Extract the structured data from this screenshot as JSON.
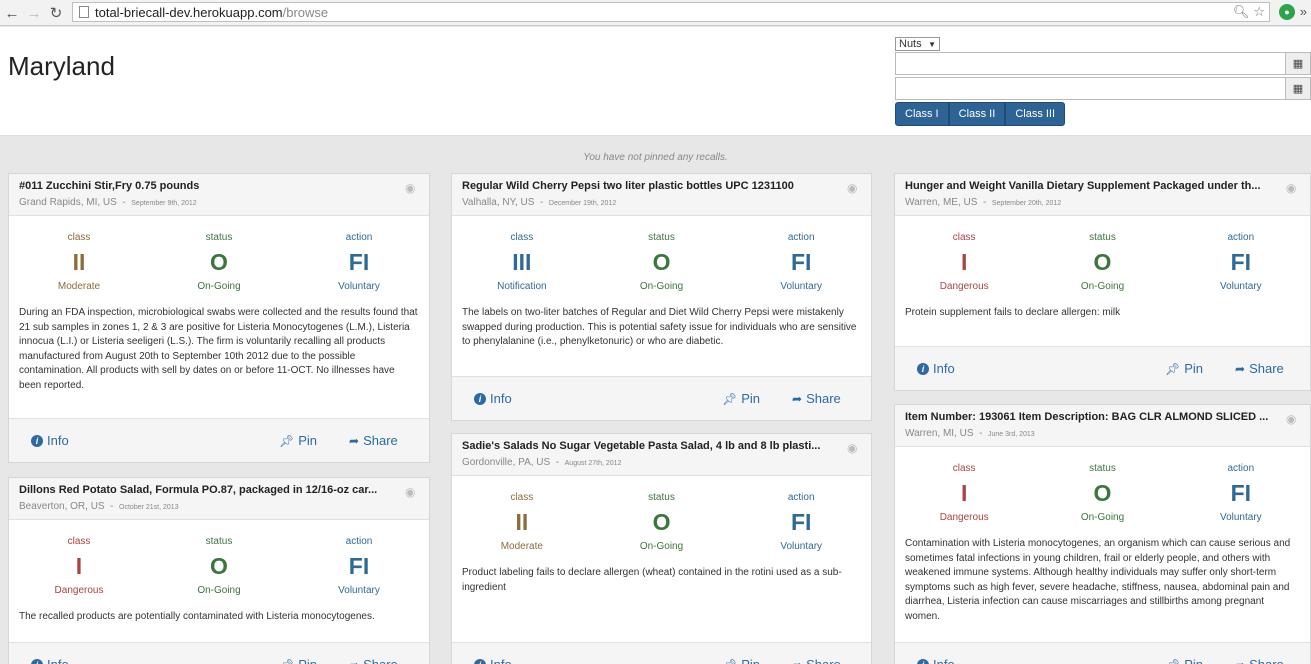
{
  "browser": {
    "url_host": "total-briecall-dev.herokuapp.com",
    "url_path": "/browse",
    "back_icon": "arrow-left-icon",
    "forward_icon": "arrow-right-icon",
    "reload_icon": "reload-icon"
  },
  "header": {
    "state": "Maryland",
    "category": "Nuts",
    "class_buttons": [
      "Class I",
      "Class II",
      "Class III"
    ]
  },
  "pinned_message": "You have not pinned any recalls.",
  "labels": {
    "class": "class",
    "status": "status",
    "action": "action",
    "info": "Info",
    "pin": "Pin",
    "share": "Share"
  },
  "cards": [
    {
      "title": "#011 Zucchini Stir,Fry 0.75 pounds",
      "location": "Grand Rapids, MI, US",
      "date": "September 9th, 2012",
      "class": "II",
      "class_desc": "Moderate",
      "status": "O",
      "status_desc": "On-Going",
      "action": "FI",
      "action_desc": "Voluntary",
      "description": "During an FDA inspection, microbiological swabs were collected and the results found that 21 sub samples in zones 1, 2 & 3 are positive for Listeria Monocytogenes (L.M.), Listeria innocua (L.I.) or Listeria seeligeri (L.S.). The firm is voluntarily recalling all products manufactured from August 20th to September 10th 2012 due to the possible contamination. All products with sell by dates on or before 11-OCT. No illnesses have been reported."
    },
    {
      "title": "Dillons Red Potato Salad, Formula PO.87, packaged in 12/16-oz car...",
      "location": "Beaverton, OR, US",
      "date": "October 21st, 2013",
      "class": "I",
      "class_desc": "Dangerous",
      "status": "O",
      "status_desc": "On-Going",
      "action": "FI",
      "action_desc": "Voluntary",
      "description": "The recalled products are potentially contaminated with Listeria monocytogenes."
    },
    {
      "title": "Regular Wild Cherry Pepsi two liter plastic bottles UPC 1231100",
      "location": "Valhalla, NY, US",
      "date": "December 19th, 2012",
      "class": "III",
      "class_desc": "Notification",
      "status": "O",
      "status_desc": "On-Going",
      "action": "FI",
      "action_desc": "Voluntary",
      "description": "The labels on two-liter batches of Regular and Diet Wild Cherry Pepsi were mistakenly swapped during production. This is potential safety issue for individuals who are sensitive to phenylalanine (i.e., phenylketonuric) or who are diabetic."
    },
    {
      "title": "Sadie's Salads No Sugar Vegetable Pasta Salad, 4 lb and 8 lb plasti...",
      "location": "Gordonville, PA, US",
      "date": "August 27th, 2012",
      "class": "II",
      "class_desc": "Moderate",
      "status": "O",
      "status_desc": "On-Going",
      "action": "FI",
      "action_desc": "Voluntary",
      "description": "Product labeling fails to declare allergen (wheat) contained in the rotini used as a sub-ingredient"
    },
    {
      "title": "Hunger and Weight Vanilla Dietary Supplement Packaged under th...",
      "location": "Warren, ME, US",
      "date": "September 20th, 2012",
      "class": "I",
      "class_desc": "Dangerous",
      "status": "O",
      "status_desc": "On-Going",
      "action": "FI",
      "action_desc": "Voluntary",
      "description": "Protein supplement fails to declare allergen: milk"
    },
    {
      "title": "Item Number: 193061 Item Description: BAG CLR ALMOND SLICED ...",
      "location": "Warren, MI, US",
      "date": "June 3rd, 2013",
      "class": "I",
      "class_desc": "Dangerous",
      "status": "O",
      "status_desc": "On-Going",
      "action": "FI",
      "action_desc": "Voluntary",
      "description": "Contamination with Listeria monocytogenes, an organism which can cause serious and sometimes fatal infections in young children, frail or elderly people, and others with weakened immune systems. Although healthy individuals may suffer only short-term symptoms such as high fever, severe headache, stiffness, nausea, abdominal pain and diarrhea, Listeria infection can cause miscarriages and stillbirths among pregnant women."
    }
  ]
}
